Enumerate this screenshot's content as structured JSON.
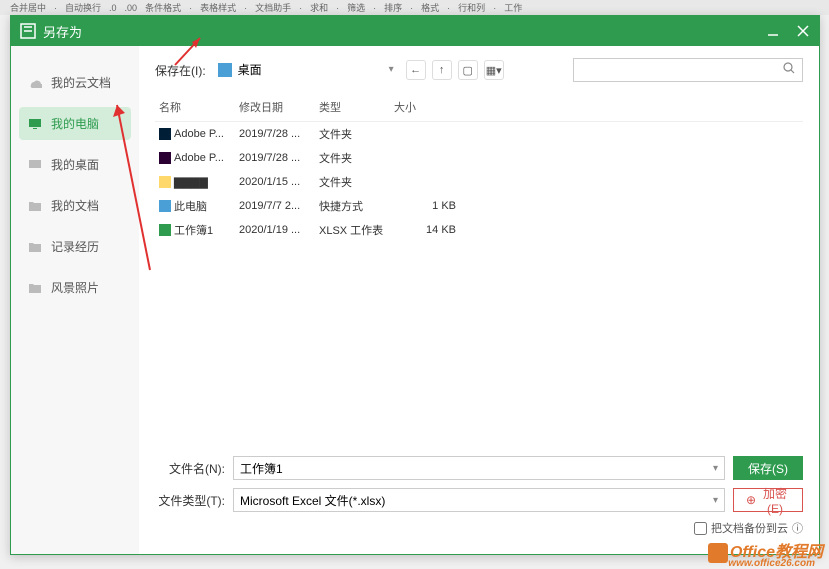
{
  "toolbar_hints": [
    "合并居中",
    "自动换行",
    ".0",
    ".00",
    "条件格式",
    "表格样式",
    "文档助手",
    "求和",
    "筛选",
    "排序",
    "格式",
    "行和列",
    "工作"
  ],
  "dialog": {
    "title": "另存为",
    "save_in_label": "保存在(I):",
    "location": "桌面",
    "search_placeholder": "",
    "filename_label": "文件名(N):",
    "filename_value": "工作簿1",
    "filetype_label": "文件类型(T):",
    "filetype_value": "Microsoft Excel 文件(*.xlsx)",
    "save_btn": "保存(S)",
    "encrypt_btn": "加密(E)",
    "checkbox_label": "把文档备份到云"
  },
  "sidebar": {
    "items": [
      {
        "label": "我的云文档",
        "icon": "cloud"
      },
      {
        "label": "我的电脑",
        "icon": "computer",
        "active": true
      },
      {
        "label": "我的桌面",
        "icon": "desktop"
      },
      {
        "label": "我的文档",
        "icon": "folder"
      },
      {
        "label": "记录经历",
        "icon": "folder"
      },
      {
        "label": "风景照片",
        "icon": "folder"
      }
    ]
  },
  "file_list": {
    "headers": {
      "name": "名称",
      "date": "修改日期",
      "type": "类型",
      "size": "大小"
    },
    "rows": [
      {
        "name": "Adobe P...",
        "date": "2019/7/28 ...",
        "type": "文件夹",
        "size": "",
        "icon": "ps"
      },
      {
        "name": "Adobe P...",
        "date": "2019/7/28 ...",
        "type": "文件夹",
        "size": "",
        "icon": "pr"
      },
      {
        "name": "▇▇▇▇",
        "date": "2020/1/15 ...",
        "type": "文件夹",
        "size": "",
        "icon": "folder"
      },
      {
        "name": "此电脑",
        "date": "2019/7/7 2...",
        "type": "快捷方式",
        "size": "1 KB",
        "icon": "pc"
      },
      {
        "name": "工作簿1",
        "date": "2020/1/19 ...",
        "type": "XLSX 工作表",
        "size": "14 KB",
        "icon": "xlsx"
      }
    ]
  },
  "watermark": {
    "main": "Office教程网",
    "sub": "www.office26.com"
  }
}
